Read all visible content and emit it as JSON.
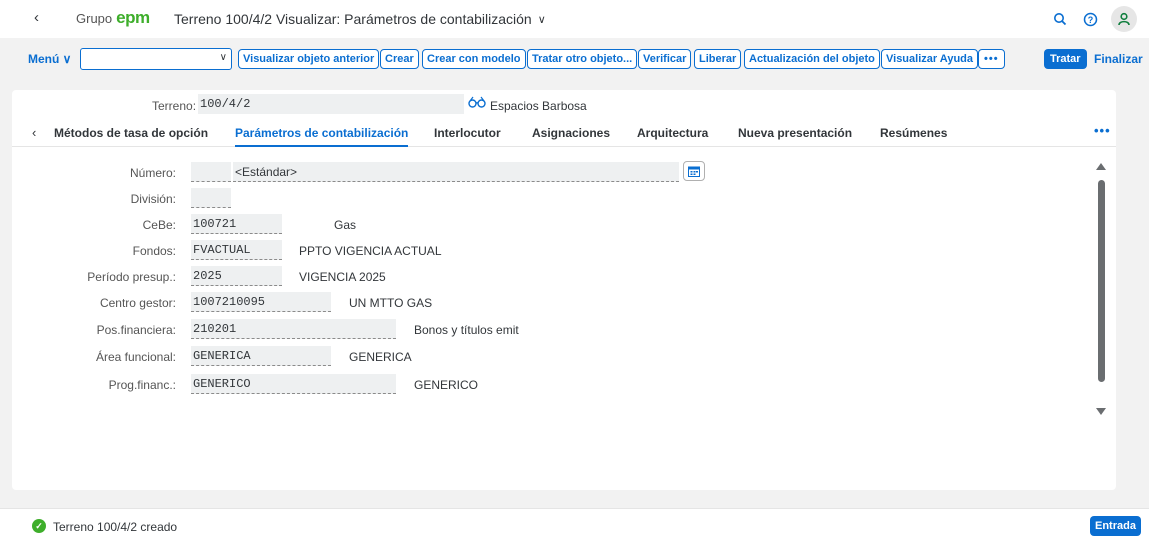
{
  "shell": {
    "back_icon": "chevron-left-icon",
    "logo_grupo": "Grupo",
    "logo_epm": "epm",
    "title": "Terreno 100/4/2 Visualizar: Parámetros de contabilización",
    "icons": [
      "search-icon",
      "help-icon",
      "user-icon"
    ]
  },
  "toolbar": {
    "menu_label": "Menú ∨",
    "command_value": "",
    "buttons": {
      "prev": "Visualizar objeto anterior",
      "crear": "Crear",
      "modelo": "Crear con modelo",
      "otro": "Tratar otro objeto...",
      "verificar": "Verificar",
      "liberar": "Liberar",
      "actualizacion": "Actualización del objeto",
      "ayuda": "Visualizar Ayuda",
      "more": "•••"
    },
    "tratar": "Tratar",
    "finalizar": "Finalizar"
  },
  "header": {
    "label": "Terreno:",
    "value": "100/4/2",
    "desc": "Espacios Barbosa",
    "icon": "glasses-icon"
  },
  "tabs": {
    "metodos": "Métodos de tasa de opción",
    "parametros": "Parámetros de contabilización",
    "interlocutor": "Interlocutor",
    "asignaciones": "Asignaciones",
    "arquitectura": "Arquitectura",
    "nueva": "Nueva presentación",
    "resumenes": "Resúmenes",
    "more": "•••",
    "selected": "parametros"
  },
  "form": {
    "numero": {
      "label": "Número:",
      "value": "",
      "desc": "<Estándar>"
    },
    "division": {
      "label": "División:",
      "value": ""
    },
    "cebe": {
      "label": "CeBe:",
      "value": "100721",
      "desc": "Gas"
    },
    "fondos": {
      "label": "Fondos:",
      "value": "FVACTUAL",
      "desc": "PPTO VIGENCIA ACTUAL"
    },
    "periodo": {
      "label": "Período presup.:",
      "value": "2025",
      "desc": "VIGENCIA 2025"
    },
    "centro": {
      "label": "Centro gestor:",
      "value": "1007210095",
      "desc": "UN MTTO GAS"
    },
    "pos": {
      "label": "Pos.financiera:",
      "value": "210201",
      "desc": "Bonos y títulos emit"
    },
    "area": {
      "label": "Área funcional:",
      "value": "GENERICA",
      "desc": "GENERICA"
    },
    "prog": {
      "label": "Prog.financ.:",
      "value": "GENERICO",
      "desc": "GENERICO"
    }
  },
  "footer": {
    "status": "Terreno 100/4/2 creado",
    "status_icon": "success-check-icon",
    "entrada": "Entrada"
  },
  "colors": {
    "accent": "#0a6ed1",
    "brand_green": "#3eae2b",
    "field_bg": "#eef0f1"
  }
}
